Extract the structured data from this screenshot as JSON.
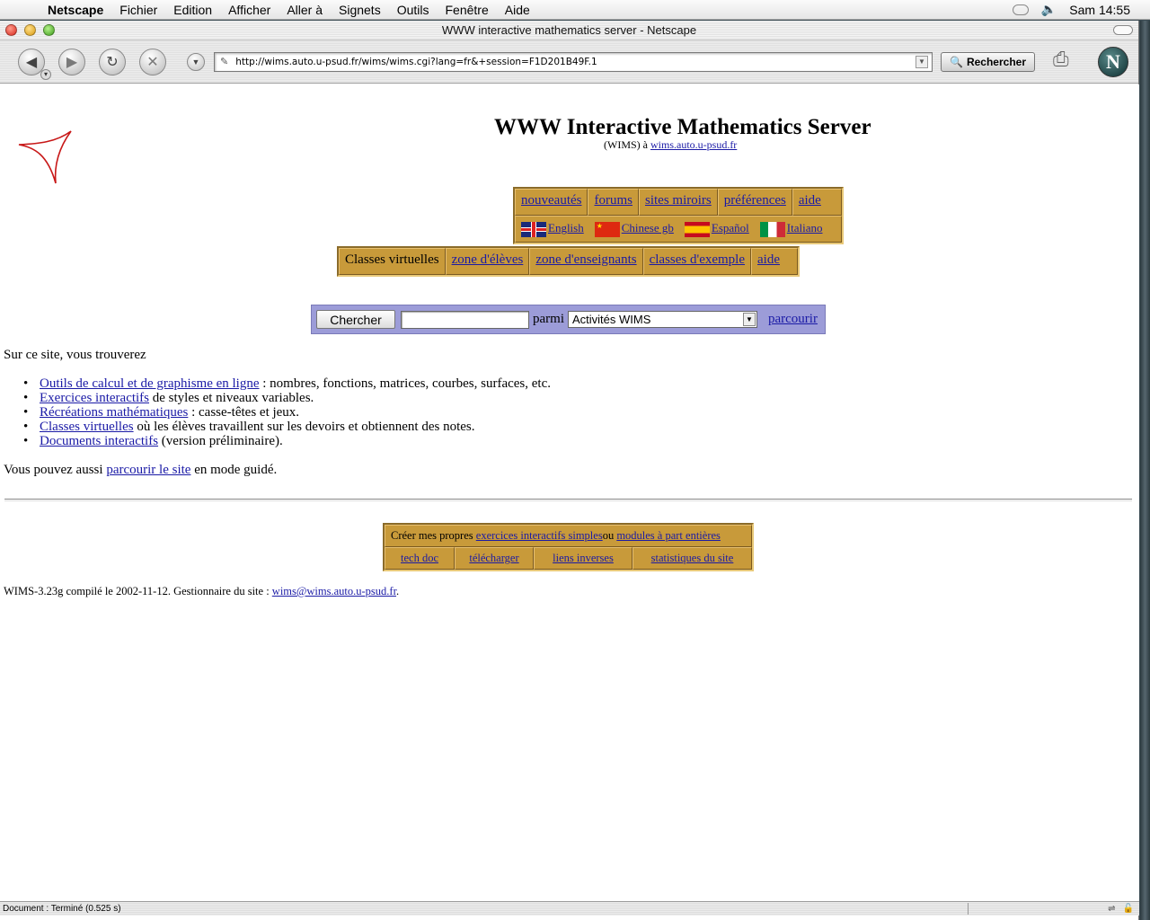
{
  "menubar": {
    "app": "Netscape",
    "items": [
      "Fichier",
      "Edition",
      "Afficher",
      "Aller à",
      "Signets",
      "Outils",
      "Fenêtre",
      "Aide"
    ],
    "clock": "Sam 14:55"
  },
  "window": {
    "title": "WWW interactive mathematics server - Netscape"
  },
  "toolbar": {
    "url": "http://wims.auto.u-psud.fr/wims/wims.cgi?lang=fr&+session=F1D201B49F.1",
    "search_label": "Rechercher"
  },
  "page": {
    "title": "WWW Interactive Mathematics Server",
    "subtitle_prefix": "(WIMS) à ",
    "subtitle_link": "wims.auto.u-psud.fr",
    "top_menu": [
      "nouveautés",
      "forums",
      "sites miroirs",
      "préférences",
      "aide"
    ],
    "languages": [
      "English",
      "Chinese gb",
      "Español",
      "Italiano"
    ],
    "class_menu": {
      "current": "Classes virtuelles",
      "links": [
        "zone d'élèves",
        "zone d'enseignants",
        "classes d'exemple",
        "aide"
      ]
    },
    "search": {
      "button": "Chercher",
      "input_value": "",
      "parmi": "parmi",
      "scope": "Activités WIMS",
      "browse": "parcourir"
    },
    "intro": "Sur ce site, vous trouverez",
    "features": [
      {
        "link": "Outils de calcul et de graphisme en ligne",
        "text": " : nombres, fonctions, matrices, courbes, surfaces, etc."
      },
      {
        "link": "Exercices interactifs",
        "text": " de styles et niveaux variables."
      },
      {
        "link": "Récréations mathématiques",
        "text": " : casse-têtes et jeux."
      },
      {
        "link": "Classes virtuelles",
        "text": " où les élèves travaillent sur les devoirs et obtiennent des notes."
      },
      {
        "link": "Documents interactifs",
        "text": " (version préliminaire)."
      }
    ],
    "guided": {
      "before": "Vous pouvez aussi ",
      "link": "parcourir le site",
      "after": " en mode guidé."
    },
    "bottom_menu": {
      "create_prefix": "Créer mes propres ",
      "create_link1": "exercices interactifs simples",
      "create_mid": " ou ",
      "create_link2": "modules à part entières",
      "links": [
        "tech doc",
        "télécharger",
        "liens inverses",
        "statistiques du site"
      ]
    },
    "footer": {
      "text": "WIMS-3.23g compilé le 2002-11-12. Gestionnaire du site : ",
      "email": "wims@wims.auto.u-psud.fr",
      "end": "."
    }
  },
  "statusbar": {
    "text": "Document : Terminé (0.525 s)"
  },
  "colors": {
    "menu_gold": "#c89a3a",
    "search_bg": "#9c9cd8",
    "link": "#1a1aa6",
    "logo_red": "#c81818"
  }
}
